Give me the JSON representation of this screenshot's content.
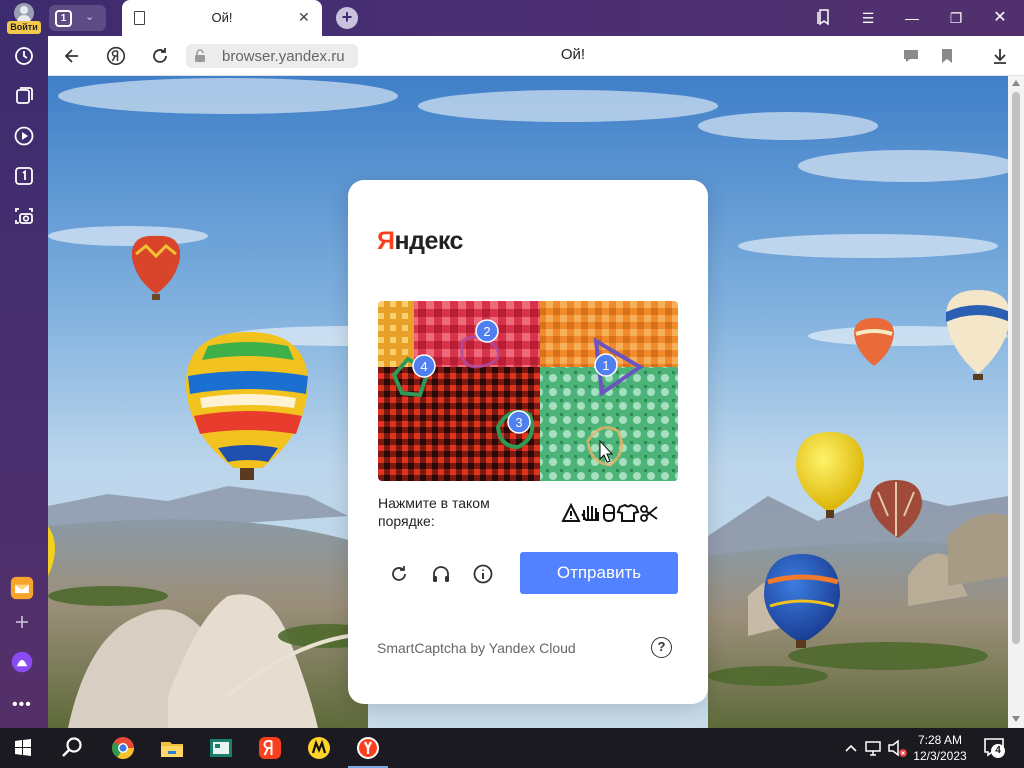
{
  "browser": {
    "login_label": "Войти",
    "tab_count": "1",
    "active_tab_title": "Ой!",
    "url": "browser.yandex.ru",
    "page_title": "Ой!"
  },
  "captcha": {
    "logo_ya": "Я",
    "logo_rest": "ндекс",
    "markers": [
      "1",
      "2",
      "3",
      "4"
    ],
    "instruction": "Нажмите в таком порядке:",
    "order_icons": [
      "warning-triangle-icon",
      "hand-icon",
      "figure-icon",
      "shirt-icon",
      "scissors-icon"
    ],
    "submit_label": "Отправить",
    "brand": "SmartCaptcha by Yandex Cloud",
    "help_label": "?",
    "accent_color": "#5282ff",
    "marker_color": "#4f7ff0"
  },
  "taskbar": {
    "time": "7:28 AM",
    "date": "12/3/2023",
    "notification_count": "4"
  }
}
